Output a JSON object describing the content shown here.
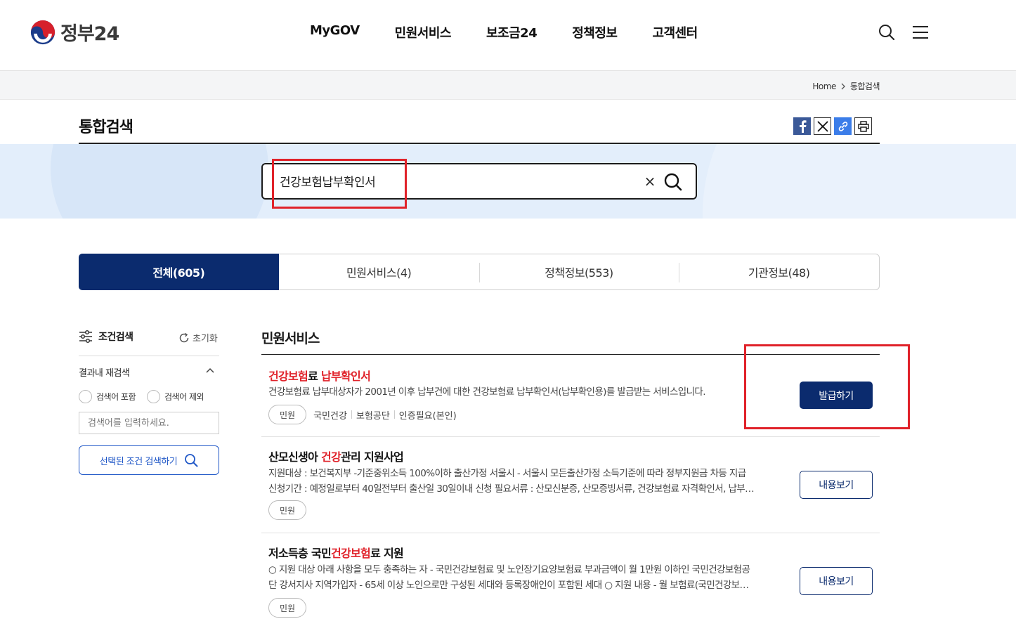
{
  "header": {
    "logo_text": "정부24",
    "nav": [
      "MyGOV",
      "민원서비스",
      "보조금24",
      "정책정보",
      "고객센터"
    ]
  },
  "breadcrumb": {
    "home": "Home",
    "current": "통합검색"
  },
  "page": {
    "title": "통합검색"
  },
  "search": {
    "query": "건강보험납부확인서",
    "clear_symbol": "×"
  },
  "tabs": [
    {
      "label": "전체(605)",
      "active": true
    },
    {
      "label": "민원서비스(4)",
      "active": false
    },
    {
      "label": "정책정보(553)",
      "active": false
    },
    {
      "label": "기관정보(48)",
      "active": false
    }
  ],
  "filter": {
    "title": "조건검색",
    "reset": "초기화",
    "refine_title": "결과내 재검색",
    "include": "검색어 포함",
    "exclude": "검색어 제외",
    "placeholder": "검색어를 입력하세요.",
    "submit": "선택된 조건 검색하기"
  },
  "results": {
    "section_title": "민원서비스",
    "items": [
      {
        "title_parts": [
          {
            "text": "건강보험",
            "highlight": true
          },
          {
            "text": "료 ",
            "highlight": false
          },
          {
            "text": "납부확인서",
            "highlight": true
          }
        ],
        "desc_lines": [
          "건강보험료 납부대상자가 2001년 이후 납부건에 대한 건강보험료 납부확인서(납부확인용)를 발급받는 서비스입니다."
        ],
        "pill": "민원",
        "tags": [
          "국민건강",
          "보험공단",
          "인증필요(본인)"
        ],
        "button": "발급하기"
      },
      {
        "title_parts": [
          {
            "text": "산모신생아 ",
            "highlight": false
          },
          {
            "text": "건강",
            "highlight": true
          },
          {
            "text": "관리 지원사업",
            "highlight": false
          }
        ],
        "desc_lines": [
          "지원대상 : 보건복지부 -기준중위소득 100%이하 출산가정 서울시 - 서울시 모든출산가정 소득기준에 따라 정부지원금 차등 지급",
          "신청기간 : 예정일로부터 40일전부터 출산일 30일이내 신청 필요서류 : 산모신분증, 산모증빙서류, 건강보험료 자격확인서, 납부…"
        ],
        "pill": "민원",
        "tags": [],
        "button": "내용보기"
      },
      {
        "title_parts": [
          {
            "text": "저소득층 국민",
            "highlight": false
          },
          {
            "text": "건강보험",
            "highlight": true
          },
          {
            "text": "료 지원",
            "highlight": false
          }
        ],
        "desc_lines": [
          "○ 지원 대상 아래 사항을 모두 충족하는 자 - 국민건강보험료 및 노인장기요양보험료 부과금액이 월 1만원 이하인 국민건강보험공",
          "단 강서지사 지역가입자 - 65세 이상 노인으로만 구성된 세대와 등록장애인이 포함된 세대 ○ 지원 내용 - 월 보험료(국민건강보…"
        ],
        "pill": "민원",
        "tags": [],
        "button": "내용보기"
      }
    ]
  },
  "colors": {
    "primary": "#0b2b6e",
    "highlight": "#e0222a",
    "band": "#e3eefb"
  }
}
